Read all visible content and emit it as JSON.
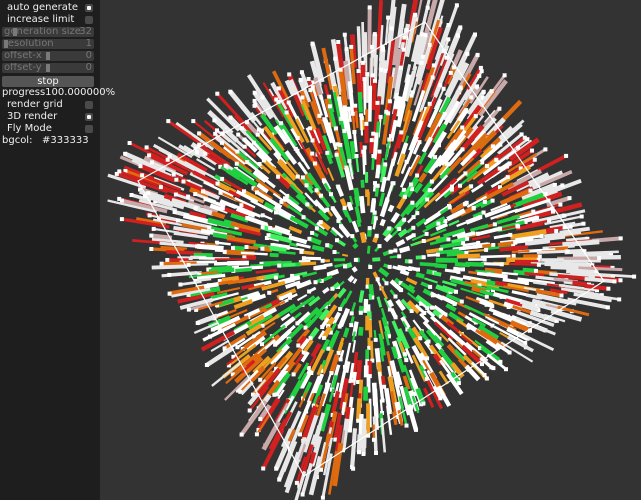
{
  "panel": {
    "auto_generate": {
      "label": "auto generate",
      "checked": true
    },
    "increase_limit": {
      "label": "increase limit",
      "checked": false
    },
    "generation_size": {
      "label": "generation size",
      "value": "32",
      "level": 0.12
    },
    "resolution": {
      "label": "resolution",
      "value": "1",
      "level": 0.02
    },
    "offset_x": {
      "label": "offset-x",
      "value": "0",
      "level": 0.5
    },
    "offset_y": {
      "label": "offset-y",
      "value": "0",
      "level": 0.5
    },
    "stop_label": "stop",
    "progress": "progress100.000000%",
    "render_grid": {
      "label": "render grid",
      "checked": false
    },
    "render_3d": {
      "label": "3D render",
      "checked": true
    },
    "fly_mode": {
      "label": "Fly Mode",
      "checked": false
    },
    "bgcol_label": "bgcol:",
    "bgcol_value": "#333333"
  },
  "colors": {
    "background": "#333333",
    "panel": "#1e1e1e",
    "bars": [
      "#ffffff",
      "#e8e8e8",
      "#d02020",
      "#e06a10",
      "#f0a020",
      "#20d040",
      "#40f060",
      "#c8a8a8"
    ]
  }
}
